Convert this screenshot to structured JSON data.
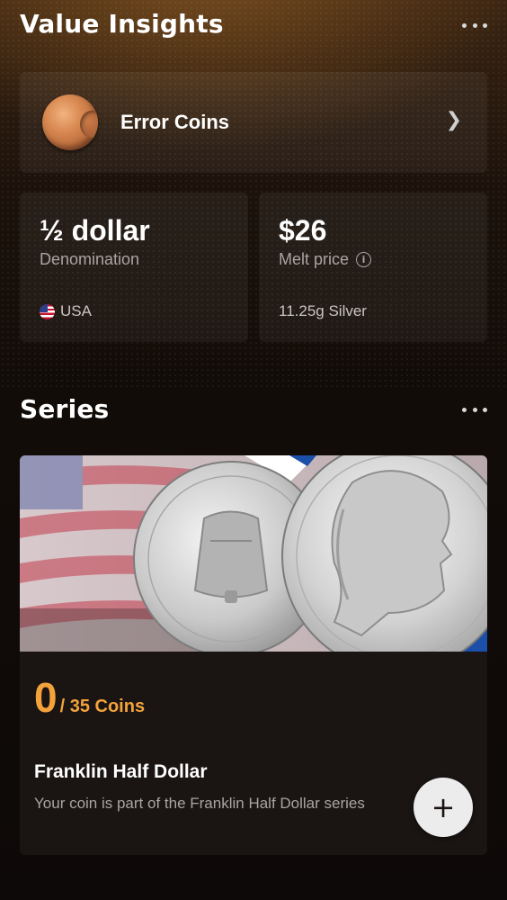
{
  "value_insights": {
    "title": "Value Insights",
    "more_icon": "more-horizontal-icon",
    "category": {
      "label": "Error Coins",
      "icon": "coin-thumbnail",
      "chevron_icon": "chevron-right-icon"
    },
    "denomination": {
      "value": "½ dollar",
      "caption": "Denomination",
      "country_flag_icon": "us-flag-icon",
      "country": "USA"
    },
    "melt_price": {
      "value": "$26",
      "caption": "Melt price",
      "info_icon": "info-icon",
      "info_glyph": "i",
      "composition": "11.25g Silver"
    }
  },
  "series": {
    "title": "Series",
    "more_icon": "more-horizontal-icon",
    "card": {
      "image": "franklin-half-dollar-coins-banner",
      "owned_count": "0",
      "total_label": "/ 35 Coins",
      "name": "Franklin Half Dollar",
      "description": "Your coin is part of the Franklin Half Dollar series",
      "add_icon": "plus-icon",
      "add_glyph": "+"
    }
  },
  "colors": {
    "accent": "#f3a33a",
    "card_bg": "#1a1413",
    "text_muted": "#a9a5a2",
    "add_button_bg": "#ececec"
  }
}
